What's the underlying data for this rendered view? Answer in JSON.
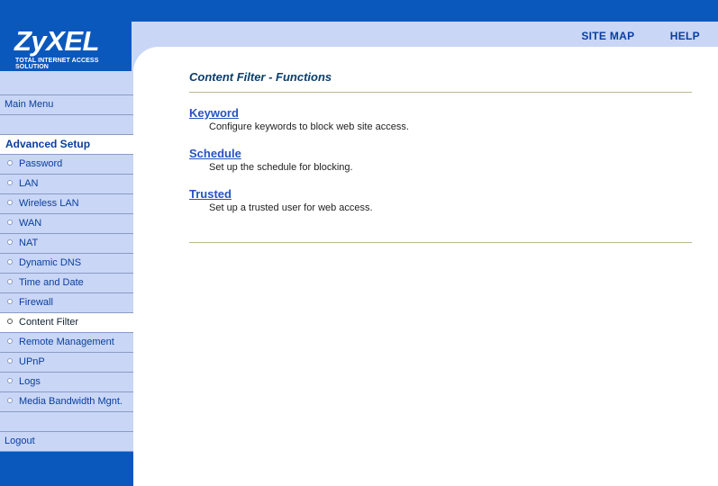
{
  "logo": {
    "brand": "ZyXEL",
    "tagline": "Total Internet Access Solution"
  },
  "header": {
    "links": [
      "SITE MAP",
      "HELP"
    ]
  },
  "sidebar": {
    "main_menu": "Main Menu",
    "section_title": "Advanced Setup",
    "items": [
      {
        "label": "Password",
        "active": false
      },
      {
        "label": "LAN",
        "active": false
      },
      {
        "label": "Wireless LAN",
        "active": false
      },
      {
        "label": "WAN",
        "active": false
      },
      {
        "label": "NAT",
        "active": false
      },
      {
        "label": "Dynamic DNS",
        "active": false
      },
      {
        "label": "Time and Date",
        "active": false
      },
      {
        "label": "Firewall",
        "active": false
      },
      {
        "label": "Content Filter",
        "active": true
      },
      {
        "label": "Remote Management",
        "active": false
      },
      {
        "label": "UPnP",
        "active": false
      },
      {
        "label": "Logs",
        "active": false
      },
      {
        "label": "Media Bandwidth Mgnt.",
        "active": false
      }
    ],
    "logout": "Logout"
  },
  "main": {
    "title": "Content Filter - Functions",
    "functions": [
      {
        "title": "Keyword",
        "desc": "Configure keywords to block web site access."
      },
      {
        "title": "Schedule",
        "desc": "Set up the schedule for blocking."
      },
      {
        "title": "Trusted",
        "desc": "Set up a trusted user for web access."
      }
    ]
  },
  "colors": {
    "brand_blue": "#0b58bd",
    "sidebar_bg": "#c9d6f6",
    "link": "#2a52be"
  }
}
